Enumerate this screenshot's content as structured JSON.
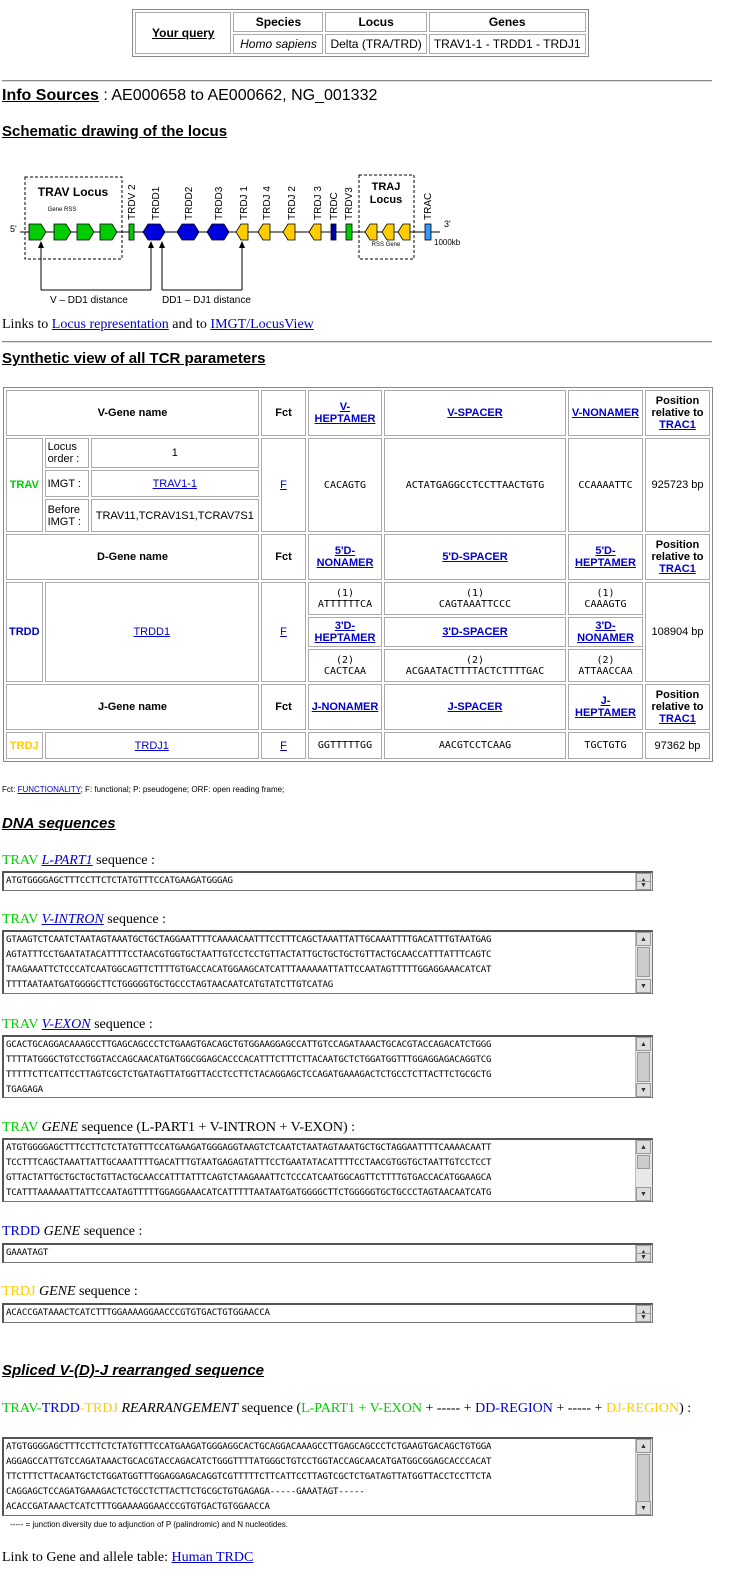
{
  "query": {
    "your_query": "Your query",
    "headers": [
      "Species",
      "Locus",
      "Genes"
    ],
    "values": [
      "Homo sapiens",
      "Delta (TRA/TRD)",
      "TRAV1-1 - TRDD1 - TRDJ1"
    ]
  },
  "info_sources": {
    "label": "Info Sources",
    "value": " : AE000658 to AE000662, NG_001332"
  },
  "schematic": {
    "title": "Schematic drawing of the locus",
    "trav_locus": "TRAV Locus",
    "gene_rss": "Gene RSS",
    "traj_locus_1": "TRAJ",
    "traj_locus_2": "Locus",
    "rss_gene": "RSS Gene",
    "five": "5'",
    "three": "3'",
    "scale": "1000kb",
    "gene_labels": [
      "TRDV 2",
      "TRDD1",
      "TRDD2",
      "TRDD3",
      "TRDJ 1",
      "TRDJ 4",
      "TRDJ 2",
      "TRDJ 3",
      "TRDC",
      "TRDV3",
      "TRAC"
    ],
    "distance_1": "V – DD1 distance",
    "distance_2": "DD1 – DJ1 distance"
  },
  "links": {
    "prefix": "Links to ",
    "locus_rep": "Locus representation",
    "mid": " and to ",
    "locusview": "IMGT/LocusView"
  },
  "synthetic": {
    "title": "Synthetic view of all TCR parameters",
    "v_gene_name": "V-Gene name",
    "d_gene_name": "D-Gene name",
    "j_gene_name": "J-Gene name",
    "fct": "Fct",
    "position_1": "Position",
    "position_2": "relative to",
    "trac1": "TRAC1",
    "v_heptamer_1": "V-",
    "v_heptamer_2": "HEPTAMER",
    "v_spacer": "V-SPACER",
    "v_nonamer": "V-NONAMER",
    "trav": "TRAV",
    "locus_order_1": "Locus",
    "locus_order_2": "order :",
    "locus_order_value": "1",
    "imgt": "IMGT :",
    "trav_gene": "TRAV1-1",
    "before_imgt_1": "Before",
    "before_imgt_2": "IMGT :",
    "before_imgt_value": "TRAV11,TCRAV1S1,TCRAV7S1",
    "trav_fct": "F",
    "trav_heptamer": "CACAGTG",
    "trav_spacer": "ACTATGAGGCCTCCTTAACTGTG",
    "trav_nonamer": "CCAAAATTC",
    "trav_position": "925723 bp",
    "d5_nonamer_1": "5'D-",
    "d5_nonamer_2": "NONAMER",
    "d5_spacer": "5'D-SPACER",
    "d5_heptamer_1": "5'D-",
    "d5_heptamer_2": "HEPTAMER",
    "trdd": "TRDD",
    "trdd_gene": "TRDD1",
    "trdd_fct": "F",
    "one": "(1)",
    "two": "(2)",
    "trdd_5nonamer": "ATTTTTTCA",
    "trdd_5spacer": "CAGTAAATTCCC",
    "trdd_5heptamer": "CAAAGTG",
    "d3_heptamer_1": "3'D-",
    "d3_heptamer_2": "HEPTAMER",
    "d3_spacer": "3'D-SPACER",
    "d3_nonamer_1": "3'D-",
    "d3_nonamer_2": "NONAMER",
    "trdd_3heptamer": "CACTCAA",
    "trdd_3spacer": "ACGAATACTTTTACTCTTTTGAC",
    "trdd_3nonamer": "ATTAACCAA",
    "trdd_position": "108904 bp",
    "j_nonamer": "J-NONAMER",
    "j_spacer": "J-SPACER",
    "j_heptamer_1": "J-",
    "j_heptamer_2": "HEPTAMER",
    "trdj": "TRDJ",
    "trdj_gene": "TRDJ1",
    "trdj_fct": "F",
    "trdj_nonamer": "GGTTTTTGG",
    "trdj_spacer": "AACGTCCTCAAG",
    "trdj_heptamer": "TGCTGTG",
    "trdj_position": "97362 bp"
  },
  "fct_note": {
    "prefix": "Fct: ",
    "functionality": "FUNCTIONALITY",
    "rest": "; F: functional; P: pseudogene; ORF: open reading frame;"
  },
  "dna": {
    "title": "DNA sequences",
    "sequence_word": " sequence :",
    "trav": "TRAV",
    "trdd": "TRDD",
    "trdj": "TRDJ",
    "l_part1": "L-PART1",
    "v_intron": "V-INTRON",
    "v_exon": "V-EXON",
    "gene": "GENE",
    "gene_paren": " sequence (L-PART1 + V-INTRON + V-EXON) :",
    "lpart1_seq": "ATGTGGGGAGCTTTCCTTCTCTATGTTTCCATGAAGATGGGAG",
    "vintron_seq": "GTAAGTCTCAATCTAATAGTAAATGCTGCTAGGAATTTTCAAAACAATTTCCTTTCAGCTAAATTATTGCAAATTTTGACATTTGTAATGAG\nAGTATTTCCTGAATATACATTTTCCTAACGTGGTGCTAATTGTCCTCCTGTTACTATTGCTGCTGCTGTTACTGCAACCATTTATTTCAGTC\nTAAGAAATTCTCCCATCAATGGCAGTTCTTTTGTGACCACATGGAAGCATCATTTAAAAAATTATTCCAATAGTTTTTGGAGGAAACATCAT\nTTTTAATAATGATGGGGCTTCTGGGGGTGCTGCCCTAGTAACAATCATGTATCTTGTCATAG",
    "vexon_seq": "GCACTGCAGGACAAAGCCTTGAGCAGCCCTCTGAAGTGACAGCTGTGGAAGGAGCCATTGTCCAGATAAACTGCACGTACCAGACATCTGGG\nTTTTATGGGCTGTCCTGGTACCAGCAACATGATGGCGGAGCACCCACATTTCTTTCTTACAATGCTCTGGATGGTTTGGAGGAGACAGGTCG\nTTTTTCTTCATTCCTTAGTCGCTCTGATAGTTATGGTTACCTCCTTCTACAGGAGCTCCAGATGAAAGACTCTGCCTCTTACTTCTGCGCTG\nTGAGAGA",
    "gene_seq": "ATGTGGGGAGCTTTCCTTCTCTATGTTTCCATGAAGATGGGAGGTAAGTCTCAATCTAATAGTAAATGCTGCTAGGAATTTTCAAAACAATT\nTCCTTTCAGCTAAATTATTGCAAATTTTGACATTTGTAATGAGAGTATTTCCTGAATATACATTTTCCTAACGTGGTGCTAATTGTCCTCCT\nGTTACTATTGCTGCTGCTGTTACTGCAACCATTTATTTCAGTCTAAGAAATTCTCCCATCAATGGCAGTTCTTTTGTGACCACATGGAAGCA\nTCATTTAAAAAATTATTCCAATAGTTTTTGGAGGAAACATCATTTTTAATAATGATGGGGCTTCTGGGGGTGCTGCCCTAGTAACAATCATG",
    "trdd_seq": "GAAATAGT",
    "trdj_seq": "ACACCGATAAACTCATCTTTGGAAAAGGAACCCGTGTGACTGTGGAACCA"
  },
  "spliced": {
    "title": "Spliced V-(D)-J rearranged sequence",
    "rearrangement": "REARRANGEMENT",
    "seq_open": " sequence (",
    "lpart_vexon": "L-PART1 + V-EXON",
    "plus_dashes": " + ----- + ",
    "dd_region": "DD-REGION",
    "dj_region": "DJ-REGION",
    "close": ") :",
    "dash1": "-",
    "dash2": "-",
    "seq": "ATGTGGGGAGCTTTCCTTCTCTATGTTTCCATGAAGATGGGAGGCACTGCAGGACAAAGCCTTGAGCAGCCCTCTGAAGTGACAGCTGTGGA\nAGGAGCCATTGTCCAGATAAACTGCACGTACCAGACATCTGGGTTTTATGGGCTGTCCTGGTACCAGCAACATGATGGCGGAGCACCCACAT\nTTCTTTCTTACAATGCTCTGGATGGTTTGGAGGAGACAGGTCGTTTTTCTTCATTCCTTAGTCGCTCTGATAGTTATGGTTACCTCCTTCTA\nCAGGAGCTCCAGATGAAAGACTCTGCCTCTTACTTCTGCGCTGTGAGAGA-----GAAATAGT-----\nACACCGATAAACTCATCTTTGGAAAAGGAACCCGTGTGACTGTGGAACCA",
    "junction_note": "----- = junction diversity due to adjunction of P (palindromic) and N nucleotides."
  },
  "footer": {
    "prefix": "Link to Gene and allele table: ",
    "link": "Human TRDC"
  },
  "colors": {
    "green": "#00cc00",
    "blue": "#0000cc",
    "yellow": "#ffcc00"
  }
}
